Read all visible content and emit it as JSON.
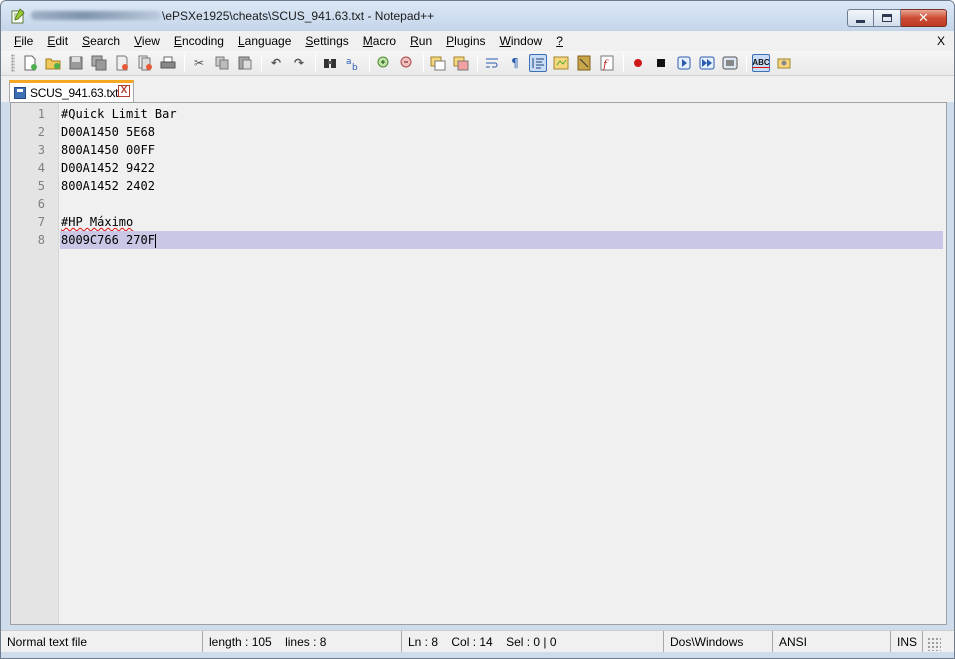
{
  "window": {
    "title": "\\ePSXe1925\\cheats\\SCUS_941.63.txt - Notepad++"
  },
  "menu": {
    "items": [
      {
        "u": "F",
        "rest": "ile"
      },
      {
        "u": "E",
        "rest": "dit"
      },
      {
        "u": "S",
        "rest": "earch"
      },
      {
        "u": "V",
        "rest": "iew"
      },
      {
        "u": "E",
        "rest": "ncoding"
      },
      {
        "u": "L",
        "rest": "anguage"
      },
      {
        "u": "S",
        "rest": "ettings"
      },
      {
        "u": "M",
        "rest": "acro"
      },
      {
        "u": "R",
        "rest": "un"
      },
      {
        "u": "P",
        "rest": "lugins"
      },
      {
        "u": "W",
        "rest": "indow"
      },
      {
        "u": "?",
        "rest": ""
      }
    ],
    "close_label": "X"
  },
  "toolbar": {
    "spellcheck_label": "ABC"
  },
  "tab": {
    "label": "SCUS_941.63.txt",
    "close": "X"
  },
  "editor": {
    "line_numbers": [
      "1",
      "2",
      "3",
      "4",
      "5",
      "6",
      "7",
      "8"
    ],
    "lines": [
      "#Quick Limit Bar",
      "D00A1450 5E68",
      "800A1450 00FF",
      "D00A1452 9422",
      "800A1452 2402",
      "",
      "#HP Máximo",
      "8009C766 270F"
    ],
    "current_line_index": 7
  },
  "status": {
    "file_type": "Normal text file",
    "length": "length : 105",
    "lines": "lines : 8",
    "ln": "Ln : 8",
    "col": "Col : 14",
    "sel": "Sel : 0 | 0",
    "eol": "Dos\\Windows",
    "encoding": "ANSI",
    "mode": "INS"
  },
  "colors": {
    "current_line": "#c9c7e6",
    "tab_accent": "#f5a623",
    "close_button": "#cc4b33"
  }
}
